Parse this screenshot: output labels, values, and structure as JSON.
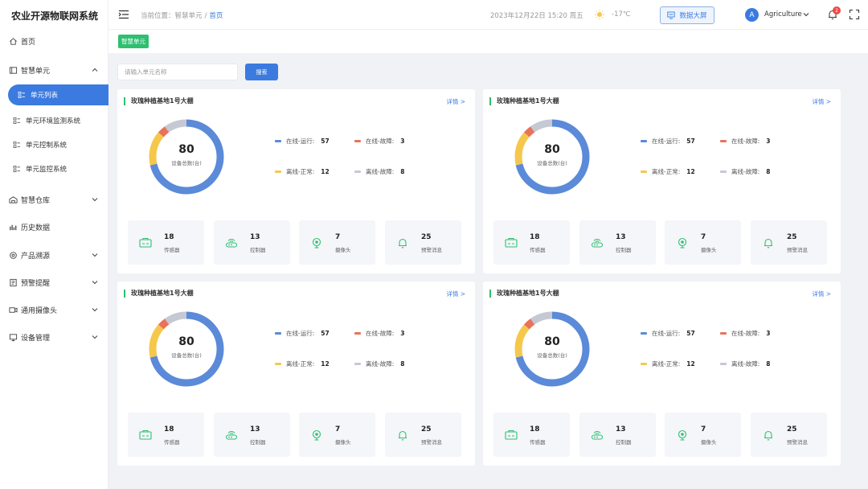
{
  "app": {
    "title": "农业开源物联网系统"
  },
  "sidebar": {
    "items": [
      {
        "label": "首页",
        "icon": "home-icon"
      },
      {
        "label": "智慧单元",
        "icon": "unit-icon",
        "expanded": true
      },
      {
        "label": "智慧仓库",
        "icon": "warehouse-icon"
      },
      {
        "label": "历史数据",
        "icon": "chart-icon"
      },
      {
        "label": "产品溯源",
        "icon": "trace-icon"
      },
      {
        "label": "预警提醒",
        "icon": "alert-icon"
      },
      {
        "label": "通用摄像头",
        "icon": "camera-icon"
      },
      {
        "label": "设备管理",
        "icon": "device-icon"
      }
    ],
    "subitems": [
      {
        "label": "单元列表",
        "active": true
      },
      {
        "label": "单元环境监测系统"
      },
      {
        "label": "单元控制系统"
      },
      {
        "label": "单元监控系统"
      }
    ]
  },
  "header": {
    "breadcrumb_prefix": "当前位置：",
    "breadcrumb_parent": "智慧单元",
    "breadcrumb_sep": "/",
    "breadcrumb_current": "首页",
    "datetime": "2023年12月22日  15:20  周五",
    "temperature": "-17℃",
    "bigscreen_label": "数据大屏",
    "avatar_letter": "A",
    "username": "Agriculture",
    "notification_count": "2"
  },
  "tagbar": {
    "tag": "智慧单元"
  },
  "search": {
    "placeholder": "请输入单元名称",
    "button": "搜索"
  },
  "colors": {
    "primary": "#3b7be0",
    "green": "#2fbf71",
    "online_running": "#5b8ad9",
    "online_fault": "#e8735a",
    "offline_normal": "#f5c84c",
    "offline_fault": "#c5c9d3"
  },
  "cards": [
    {
      "title": "玫瑰种植基地1号大棚",
      "detail": "详情 >",
      "total": "80",
      "total_label": "设备总数(台)",
      "legend": [
        {
          "label": "在线-运行:",
          "value": 57
        },
        {
          "label": "在线-故障:",
          "value": 3
        },
        {
          "label": "离线-正常:",
          "value": 12
        },
        {
          "label": "离线-故障:",
          "value": 8
        }
      ],
      "stats": [
        {
          "value": "18",
          "label": "传感器"
        },
        {
          "value": "13",
          "label": "控制器"
        },
        {
          "value": "7",
          "label": "摄像头"
        },
        {
          "value": "25",
          "label": "预警消息"
        }
      ]
    },
    {
      "title": "玫瑰种植基地1号大棚",
      "detail": "详情 >",
      "total": "80",
      "total_label": "设备总数(台)",
      "legend": [
        {
          "label": "在线-运行:",
          "value": 57
        },
        {
          "label": "在线-故障:",
          "value": 3
        },
        {
          "label": "离线-正常:",
          "value": 12
        },
        {
          "label": "离线-故障:",
          "value": 8
        }
      ],
      "stats": [
        {
          "value": "18",
          "label": "传感器"
        },
        {
          "value": "13",
          "label": "控制器"
        },
        {
          "value": "7",
          "label": "摄像头"
        },
        {
          "value": "25",
          "label": "预警消息"
        }
      ]
    },
    {
      "title": "玫瑰种植基地1号大棚",
      "detail": "详情 >",
      "total": "80",
      "total_label": "设备总数(台)",
      "legend": [
        {
          "label": "在线-运行:",
          "value": 57
        },
        {
          "label": "在线-故障:",
          "value": 3
        },
        {
          "label": "离线-正常:",
          "value": 12
        },
        {
          "label": "离线-故障:",
          "value": 8
        }
      ],
      "stats": [
        {
          "value": "18",
          "label": "传感器"
        },
        {
          "value": "13",
          "label": "控制器"
        },
        {
          "value": "7",
          "label": "摄像头"
        },
        {
          "value": "25",
          "label": "预警消息"
        }
      ]
    },
    {
      "title": "玫瑰种植基地1号大棚",
      "detail": "详情 >",
      "total": "80",
      "total_label": "设备总数(台)",
      "legend": [
        {
          "label": "在线-运行:",
          "value": 57
        },
        {
          "label": "在线-故障:",
          "value": 3
        },
        {
          "label": "离线-正常:",
          "value": 12
        },
        {
          "label": "离线-故障:",
          "value": 8
        }
      ],
      "stats": [
        {
          "value": "18",
          "label": "传感器"
        },
        {
          "value": "13",
          "label": "控制器"
        },
        {
          "value": "7",
          "label": "摄像头"
        },
        {
          "value": "25",
          "label": "预警消息"
        }
      ]
    }
  ]
}
